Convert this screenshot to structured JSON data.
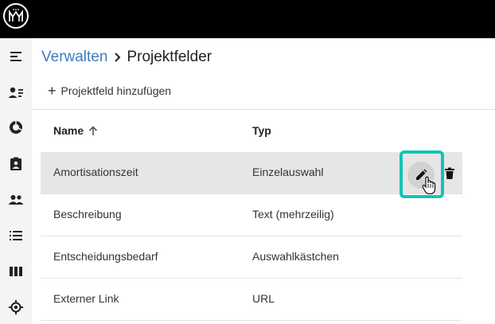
{
  "app": {
    "logo_icon": "mm-logo-icon"
  },
  "sidebar": {
    "items": [
      {
        "icon": "menu-collapse-icon"
      },
      {
        "icon": "person-list-icon"
      },
      {
        "icon": "donut-chart-icon"
      },
      {
        "icon": "badge-clipboard-icon"
      },
      {
        "icon": "people-icon"
      },
      {
        "icon": "list-icon"
      },
      {
        "icon": "columns-icon"
      },
      {
        "icon": "target-icon"
      }
    ]
  },
  "breadcrumb": {
    "parent": "Verwalten",
    "current": "Projektfelder"
  },
  "toolbar": {
    "add_label": "Projektfeld hinzufügen"
  },
  "table": {
    "columns": {
      "name": "Name",
      "type": "Typ"
    },
    "sort": {
      "column": "name",
      "direction": "ascending"
    },
    "rows": [
      {
        "name": "Amortisationszeit",
        "type": "Einzelauswahl",
        "selected": true
      },
      {
        "name": "Beschreibung",
        "type": "Text (mehrzeilig)"
      },
      {
        "name": "Entscheidungsbedarf",
        "type": "Auswahlkästchen"
      },
      {
        "name": "Externer Link",
        "type": "URL"
      }
    ]
  },
  "colors": {
    "topbar": "#000000",
    "sidebar": "#f4f4f4",
    "link": "#3f7bbf",
    "selected_row": "#e6e6e6",
    "focus_highlight": "#12c4b4"
  }
}
